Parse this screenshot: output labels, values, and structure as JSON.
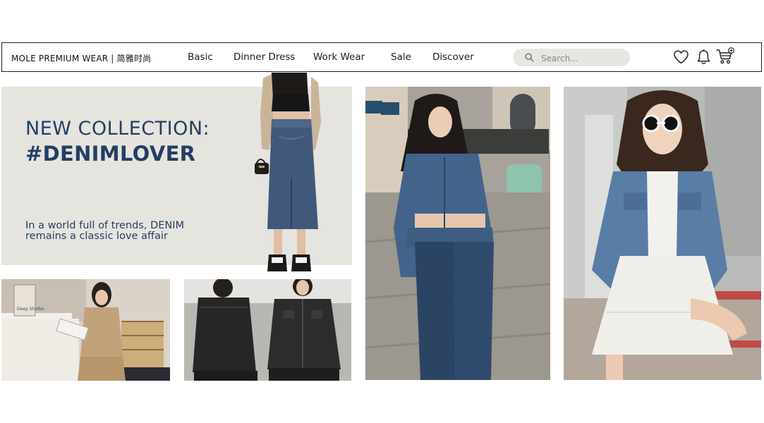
{
  "brand": "MOLE PREMIUM WEAR | 简雅时尚",
  "nav": {
    "links": [
      "Basic",
      "Dinner Dress",
      "Work Wear",
      "Sale",
      "Discover"
    ]
  },
  "search": {
    "placeholder": "Search..."
  },
  "icons": {
    "search": "search-icon",
    "wishlist": "heart-icon",
    "notifications": "bell-icon",
    "cart": "cart-add-icon"
  },
  "hero": {
    "line1": "NEW COLLECTION:",
    "line2": "#DENIMLOVER",
    "subtitle": "In a world full of trends, DENIM remains a classic love affair",
    "text_color": "#233f63",
    "background": "#e6e4df"
  },
  "tiles": {
    "bookstore_sign": "Deep Shelter"
  }
}
